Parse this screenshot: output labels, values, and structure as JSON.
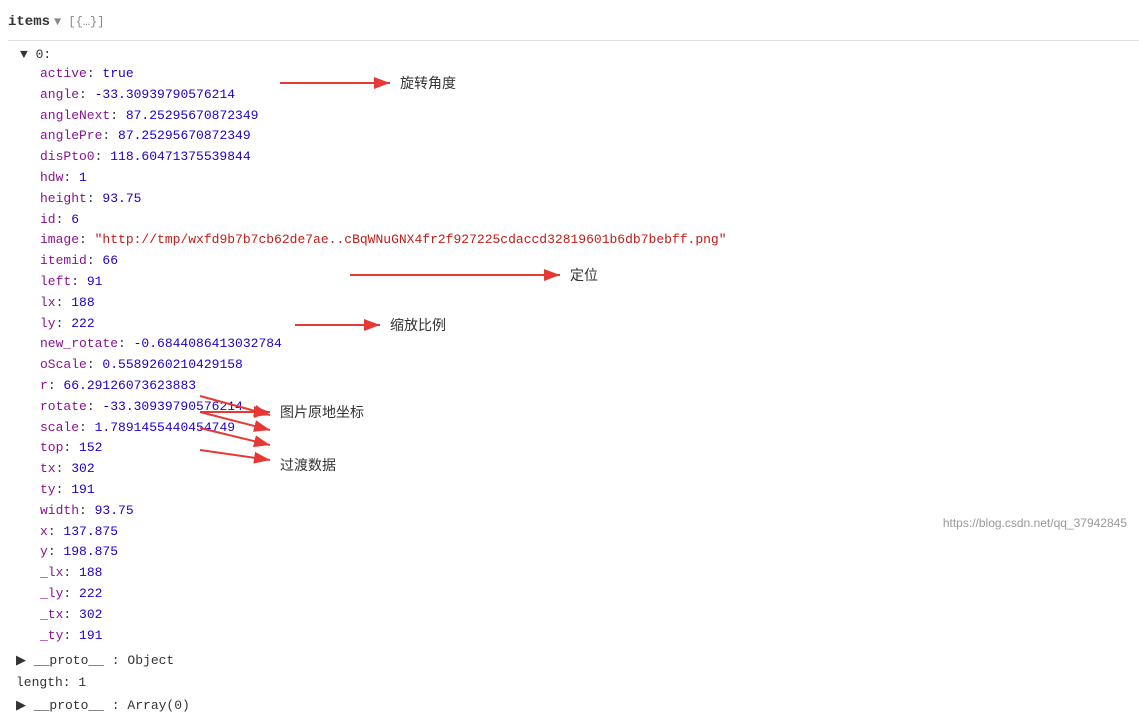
{
  "header": {
    "items_label": "items",
    "array_hint": "▼ [{…}]",
    "expand_icon": "▼"
  },
  "item_index": "▼ 0:",
  "properties": [
    {
      "key": "active",
      "value": "true",
      "type": "bool"
    },
    {
      "key": "angle",
      "value": "-33.30939790576214",
      "type": "num"
    },
    {
      "key": "angleNext",
      "value": "87.25295670872349",
      "type": "num"
    },
    {
      "key": "anglePre",
      "value": "87.25295670872349",
      "type": "num"
    },
    {
      "key": "disPto0",
      "value": "118.60471375539844",
      "type": "num"
    },
    {
      "key": "hdw",
      "value": "1",
      "type": "num"
    },
    {
      "key": "height",
      "value": "93.75",
      "type": "num"
    },
    {
      "key": "id",
      "value": "6",
      "type": "num"
    },
    {
      "key": "image",
      "value": "\"http://tmp/wxfd9b7b7cb62de7ae..cBqWNuGNX4fr2f927225cdaccd32819601b6db7bebff.png\"",
      "type": "str"
    },
    {
      "key": "itemid",
      "value": "66",
      "type": "num"
    },
    {
      "key": "left",
      "value": "91",
      "type": "num"
    },
    {
      "key": "lx",
      "value": "188",
      "type": "num"
    },
    {
      "key": "ly",
      "value": "222",
      "type": "num"
    },
    {
      "key": "new_rotate",
      "value": "-0.6844086413032784",
      "type": "num"
    },
    {
      "key": "oScale",
      "value": "0.5589260210429158",
      "type": "num"
    },
    {
      "key": "r",
      "value": "66.29126073623883",
      "type": "num"
    },
    {
      "key": "rotate",
      "value": "-33.30939790576214",
      "type": "num"
    },
    {
      "key": "scale",
      "value": "1.7891455440454749",
      "type": "num"
    },
    {
      "key": "top",
      "value": "152",
      "type": "num"
    },
    {
      "key": "tx",
      "value": "302",
      "type": "num"
    },
    {
      "key": "ty",
      "value": "191",
      "type": "num"
    },
    {
      "key": "width",
      "value": "93.75",
      "type": "num"
    },
    {
      "key": "x",
      "value": "137.875",
      "type": "num"
    },
    {
      "key": "y",
      "value": "198.875",
      "type": "num"
    },
    {
      "key": "_lx",
      "value": "188",
      "type": "num"
    },
    {
      "key": "_ly",
      "value": "222",
      "type": "num"
    },
    {
      "key": "_tx",
      "value": "302",
      "type": "num"
    },
    {
      "key": "_ty",
      "value": "191",
      "type": "num"
    }
  ],
  "footer_lines": [
    {
      "text": "▶  __proto__ : Object",
      "type": "proto"
    },
    {
      "text": "length: 1",
      "type": "plain"
    },
    {
      "text": "▶  __proto__ : Array(0)",
      "type": "proto"
    }
  ],
  "annotations": [
    {
      "id": "rotation-label",
      "text": "旋转角度"
    },
    {
      "id": "positioning-label",
      "text": "定位"
    },
    {
      "id": "scale-label",
      "text": "缩放比例"
    },
    {
      "id": "original-coord-label",
      "text": "图片原地坐标"
    },
    {
      "id": "transition-label",
      "text": "过渡数据"
    }
  ],
  "watermark": "https://blog.csdn.net/qq_37942845"
}
